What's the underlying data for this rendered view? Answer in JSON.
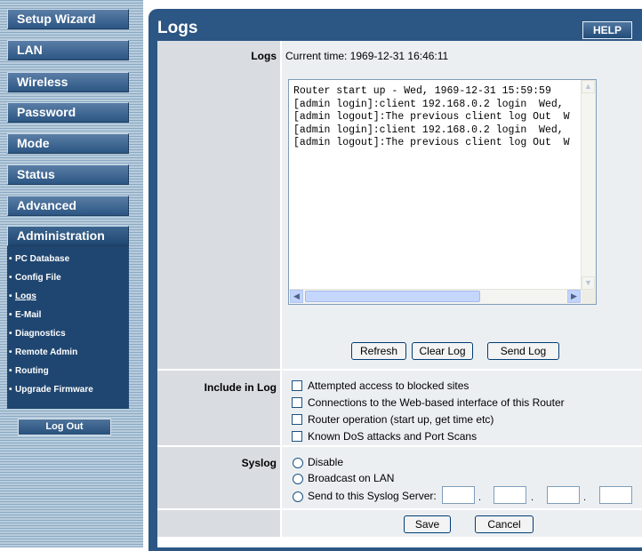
{
  "sidebar": {
    "menu": [
      {
        "label": "Setup Wizard"
      },
      {
        "label": "LAN"
      },
      {
        "label": "Wireless"
      },
      {
        "label": "Password"
      },
      {
        "label": "Mode"
      },
      {
        "label": "Status"
      },
      {
        "label": "Advanced"
      },
      {
        "label": "Administration"
      }
    ],
    "submenu": [
      {
        "label": "PC Database"
      },
      {
        "label": "Config File"
      },
      {
        "label": "Logs"
      },
      {
        "label": "E-Mail"
      },
      {
        "label": "Diagnostics"
      },
      {
        "label": "Remote Admin"
      },
      {
        "label": "Routing"
      },
      {
        "label": "Upgrade Firmware"
      }
    ],
    "logout_label": "Log Out"
  },
  "page": {
    "title": "Logs",
    "help_label": "HELP"
  },
  "logs": {
    "label": "Logs",
    "current_time": "Current time: 1969-12-31 16:46:11",
    "lines": [
      "Router start up - Wed, 1969-12-31 15:59:59",
      "[admin login]:client 192.168.0.2 login  Wed,",
      "[admin logout]:The previous client log Out  W",
      "[admin login]:client 192.168.0.2 login  Wed,",
      "[admin logout]:The previous client log Out  W"
    ],
    "buttons": {
      "refresh": "Refresh",
      "clear": "Clear Log",
      "send": "Send Log"
    }
  },
  "include": {
    "label": "Include in Log",
    "options": [
      {
        "label": "Attempted access to blocked sites"
      },
      {
        "label": "Connections to the Web-based interface of this Router"
      },
      {
        "label": "Router operation (start up, get time etc)"
      },
      {
        "label": "Known DoS attacks and Port Scans"
      }
    ]
  },
  "syslog": {
    "label": "Syslog",
    "options": [
      {
        "label": "Disable"
      },
      {
        "label": "Broadcast on LAN"
      },
      {
        "label": "Send to this Syslog Server:"
      }
    ],
    "ip_separator": "."
  },
  "actions": {
    "save": "Save",
    "cancel": "Cancel"
  },
  "colors": {
    "nav_blue": "#2c5683",
    "label_gray": "#d9dde2",
    "field_gray": "#eceff2"
  }
}
